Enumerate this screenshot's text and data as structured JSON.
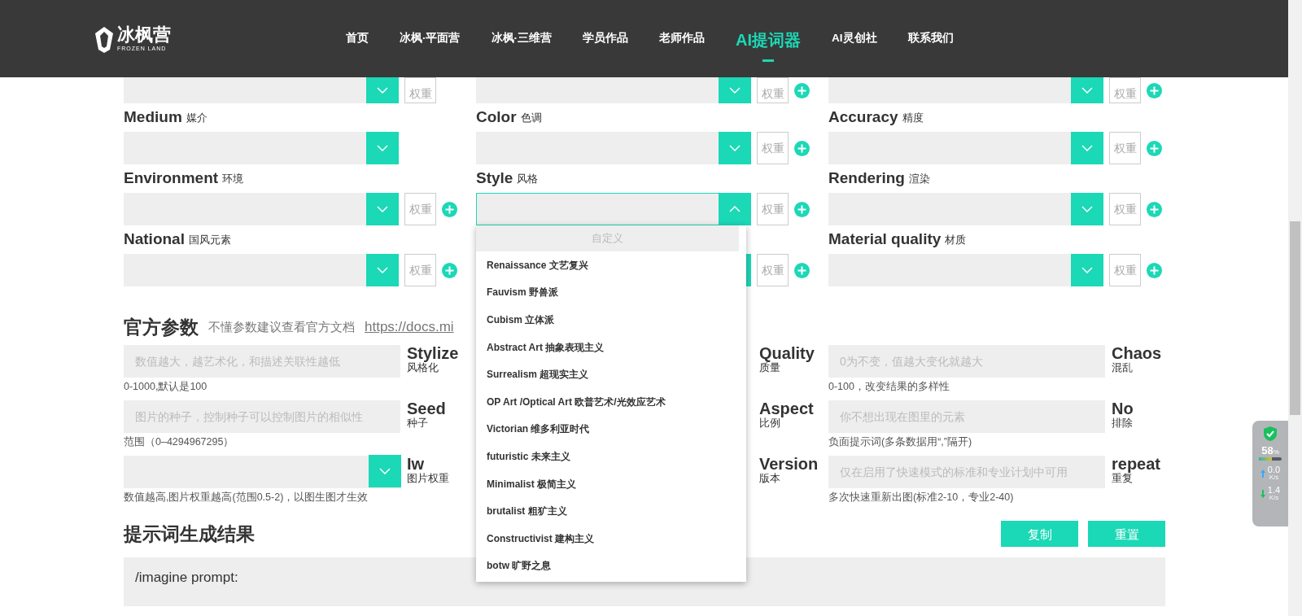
{
  "header": {
    "logo": {
      "name": "冰枫营",
      "subtitle": "FROZEN LAND"
    },
    "nav": [
      {
        "label": "首页",
        "selected": false
      },
      {
        "label": "冰枫·平面营",
        "selected": false
      },
      {
        "label": "冰枫·三维营",
        "selected": false
      },
      {
        "label": "学员作品",
        "selected": false
      },
      {
        "label": "老师作品",
        "selected": false
      },
      {
        "label": "AI提词器",
        "selected": true
      },
      {
        "label": "AI灵创社",
        "selected": false
      },
      {
        "label": "联系我们",
        "selected": false
      }
    ]
  },
  "description": {
    "fields": [
      {
        "weight": "权重",
        "add": false,
        "expanded": false
      },
      {
        "weight": "权重",
        "add": true,
        "expanded": false
      },
      {
        "weight": "权重",
        "add": true,
        "expanded": false
      },
      {
        "label": "Medium",
        "label_cn": "媒介",
        "add": false,
        "expanded": false
      },
      {
        "label": "Color",
        "label_cn": "色调",
        "weight": "权重",
        "add": true,
        "expanded": false
      },
      {
        "label": "Accuracy",
        "label_cn": "精度",
        "weight": "权重",
        "add": true,
        "expanded": false
      },
      {
        "label": "Environment",
        "label_cn": "环境",
        "weight": "权重",
        "add": true,
        "expanded": false
      },
      {
        "label": "Style",
        "label_cn": "风格",
        "weight": "权重",
        "add": true,
        "expanded": true,
        "options_header": "自定义",
        "options": [
          "Renaissance 文艺复兴",
          "Fauvism 野兽派",
          "Cubism 立体派",
          "Abstract Art  抽象表现主义",
          "Surrealism 超现实主义",
          "OP Art /Optical Art 欧普艺术/光效应艺术",
          "Victorian 维多利亚时代",
          "futuristic 未来主义",
          "Minimalist 极简主义",
          "brutalist 粗犷主义",
          "Constructivist 建构主义",
          "botw 旷野之息"
        ]
      },
      {
        "label": "Rendering",
        "label_cn": "渲染",
        "weight": "权重",
        "add": true,
        "expanded": false
      },
      {
        "label": "National",
        "label_cn": "国风元素",
        "weight": "权重",
        "add": true,
        "expanded": false
      },
      {
        "weight": "权重",
        "add": true,
        "expanded": false
      },
      {
        "label": "Material quality",
        "label_cn": "材质",
        "weight": "权重",
        "add": true,
        "expanded": false
      }
    ]
  },
  "official": {
    "title": "官方参数",
    "note": "不懂参数建议查看官方文档",
    "link": "https://docs.mi",
    "params": [
      {
        "kind": "input",
        "placeholder": "数值越大，越艺术化，和描述关联性越低",
        "name": "Stylize",
        "name_cn": "风格化",
        "hint": "0-1000,默认是100"
      },
      {
        "kind": "covered",
        "name": "Quality",
        "name_cn": "质量"
      },
      {
        "kind": "input",
        "placeholder": "0为不变，值越大变化就越大",
        "name": "Chaos",
        "name_cn": "混乱",
        "hint": "0-100，改变结果的多样性"
      },
      {
        "kind": "input",
        "placeholder": "图片的种子，控制种子可以控制图片的相似性",
        "name": "Seed",
        "name_cn": "种子",
        "hint": "范围（0–4294967295）"
      },
      {
        "kind": "covered",
        "name": "Aspect",
        "name_cn": "比例"
      },
      {
        "kind": "input",
        "placeholder": "你不想出现在图里的元素",
        "name": "No",
        "name_cn": "排除",
        "hint": "负面提示词(多条数据用“,”隔开)"
      },
      {
        "kind": "select",
        "name": "Iw",
        "name_cn": "图片权重",
        "hint": "数值越高,图片权重越高(范围0.5-2)，以图生图才生效"
      },
      {
        "kind": "covered",
        "name": "Version",
        "name_cn": "版本"
      },
      {
        "kind": "input",
        "placeholder": "仅在启用了快速模式的标准和专业计划中可用",
        "name": "repeat",
        "name_cn": "重复",
        "hint": "多次快速重新出图(标准2-10，专业2-40)"
      }
    ]
  },
  "result": {
    "title": "提示词生成结果",
    "buttons": [
      "复制",
      "重置"
    ],
    "prompt": "/imagine prompt:"
  },
  "widget": {
    "percent": "58",
    "unit": "%",
    "level": 0.58,
    "upload": "0.0",
    "upload_unit": "K/s",
    "download": "1.4",
    "download_unit": "K/s"
  }
}
